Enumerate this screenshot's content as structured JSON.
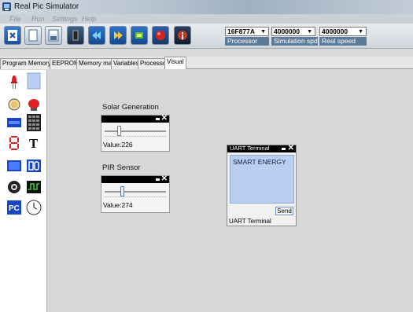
{
  "window": {
    "title": "Real Pic Simulator"
  },
  "menu": [
    "File",
    "Run",
    "Settings",
    "Help"
  ],
  "toolbar": {
    "processor": {
      "value": "16F877A",
      "caption": "Processor"
    },
    "sim_speed": {
      "value": "4000000",
      "caption": "Simulation spd"
    },
    "real_speed": {
      "value": "4000000",
      "caption": "Real speed"
    }
  },
  "tabs": [
    "Program Memory",
    "EEPROM",
    "Memory map",
    "Variables",
    "Processor",
    "Visual"
  ],
  "active_tab": "Visual",
  "palette_icons": [
    "led-icon",
    "bar-display-icon",
    "button-icon",
    "push-button-red-icon",
    "lcd-icon",
    "keypad-icon",
    "seven-segment-icon",
    "text-icon",
    "graphic-lcd-icon",
    "io-icon",
    "motor-icon",
    "signal-icon",
    "pc-icon",
    "clock-icon"
  ],
  "widgets": {
    "solar": {
      "label": "Solar Generation",
      "value_text": "Value:226",
      "level": 0.22
    },
    "pir": {
      "label": "PIR Sensor",
      "value_text": "Value:274",
      "level": 0.27
    }
  },
  "uart": {
    "title": "UART Terminal",
    "content": "SMART ENERGY",
    "send_label": "Send",
    "footer": "UART Terminal"
  }
}
